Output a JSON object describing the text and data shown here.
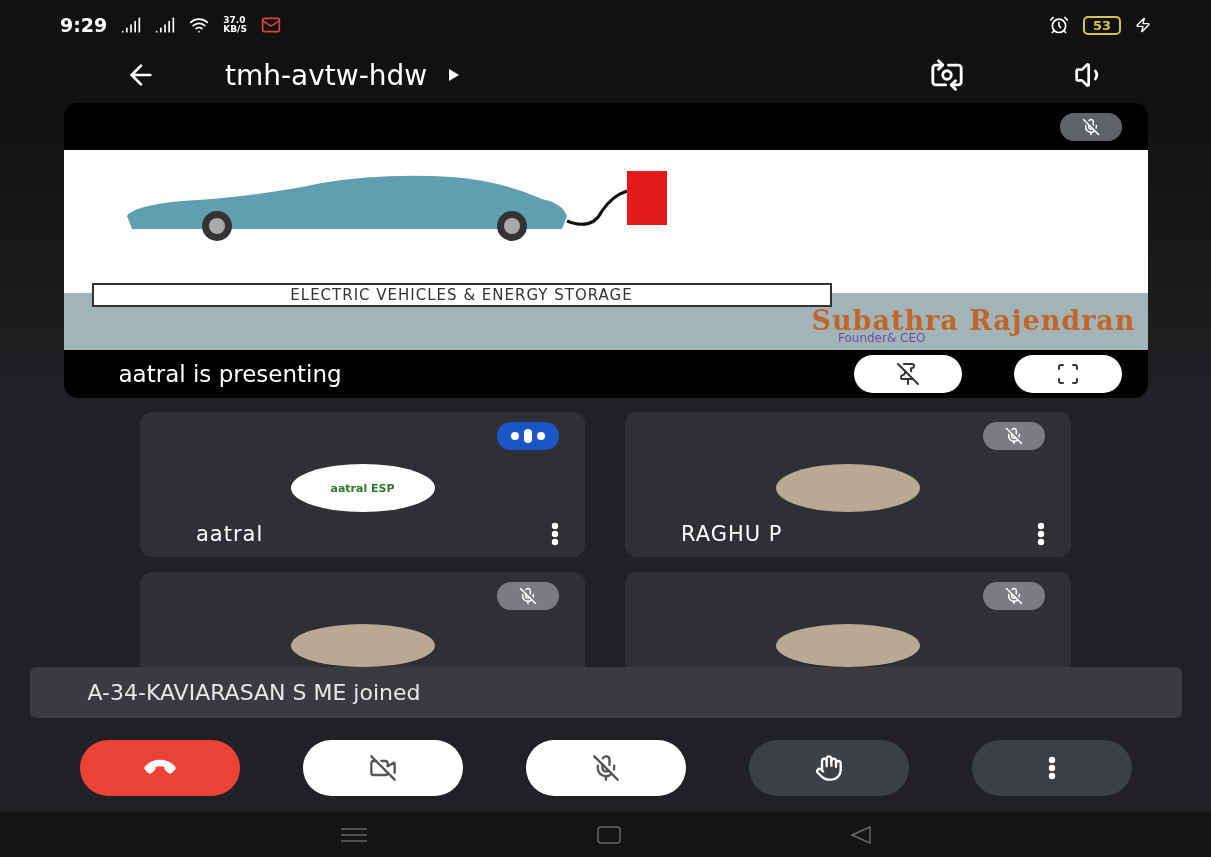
{
  "status_bar": {
    "time": "9:29",
    "speed_value": "37.0",
    "speed_unit": "KB/S",
    "battery": "53",
    "charging": true
  },
  "header": {
    "meeting_code": "tmh-avtw-hdw"
  },
  "presentation": {
    "muted": true,
    "presenter_text": "aatral is presenting",
    "slide": {
      "title": "ELECTRIC VEHICLES & ENERGY STORAGE",
      "name": "Subathra Rajendran",
      "role": "Founder& CEO"
    }
  },
  "participants": [
    {
      "name": "aatral",
      "kind": "logo",
      "avatar_text": "aatral ESP",
      "speaking": true
    },
    {
      "name": "RAGHU P",
      "kind": "photo",
      "speaking": false,
      "muted": true
    },
    {
      "kind": "photo",
      "speaking": false,
      "muted": true
    },
    {
      "kind": "photo",
      "speaking": false,
      "muted": true
    }
  ],
  "toast": "A-34-KAVIARASAN S ME joined",
  "controls": [
    {
      "kind": "end-call"
    },
    {
      "kind": "camera",
      "on": false
    },
    {
      "kind": "mic",
      "on": false
    },
    {
      "kind": "hand"
    },
    {
      "kind": "more"
    }
  ]
}
